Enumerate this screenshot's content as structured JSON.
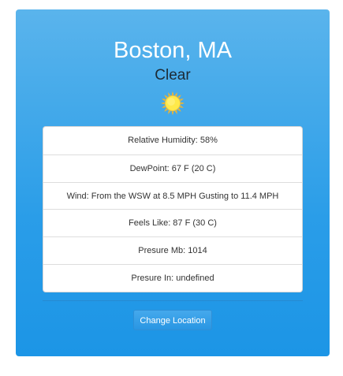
{
  "weather": {
    "location": "Boston, MA",
    "condition": "Clear",
    "condition_icon": "sun-icon",
    "details": [
      "Relative Humidity: 58%",
      "DewPoint: 67 F (20 C)",
      "Wind: From the WSW at 8.5 MPH Gusting to 11.4 MPH",
      "Feels Like: 87 F (30 C)",
      "Presure Mb: 1014",
      "Presure In: undefined"
    ],
    "change_location_label": "Change Location"
  },
  "colors": {
    "card_gradient_top": "#5ab4ec",
    "card_gradient_bottom": "#1c95e6",
    "sun_fill": "#ffe94a",
    "sun_ray": "#f5b42a"
  }
}
